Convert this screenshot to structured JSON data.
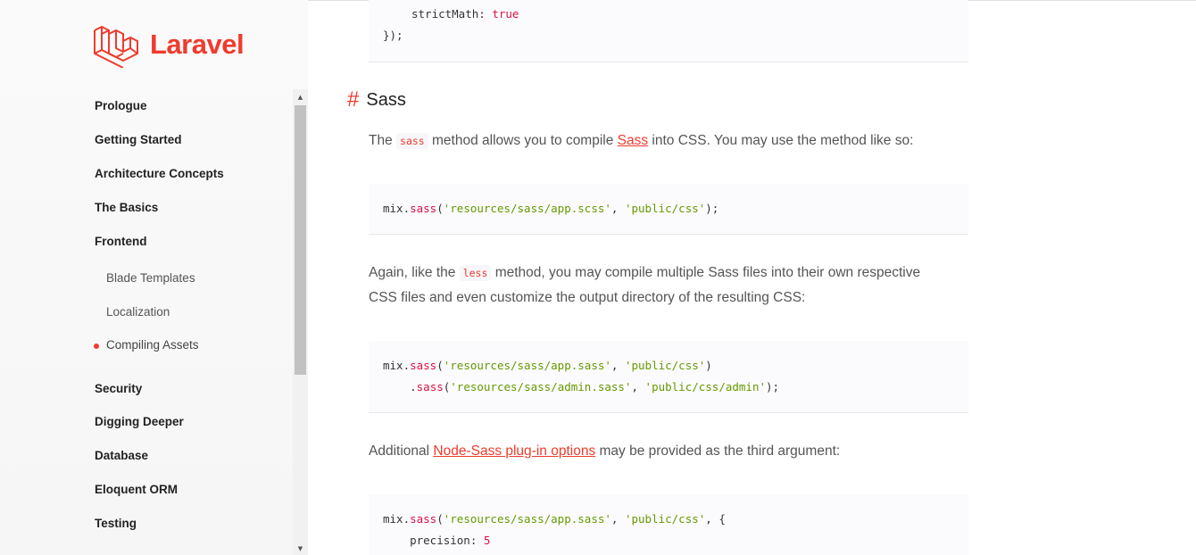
{
  "brand": {
    "name": "Laravel"
  },
  "sidebar": {
    "items": [
      {
        "label": "Prologue"
      },
      {
        "label": "Getting Started"
      },
      {
        "label": "Architecture Concepts"
      },
      {
        "label": "The Basics"
      },
      {
        "label": "Frontend"
      },
      {
        "label": "Security"
      },
      {
        "label": "Digging Deeper"
      },
      {
        "label": "Database"
      },
      {
        "label": "Eloquent ORM"
      },
      {
        "label": "Testing"
      }
    ],
    "subitems": [
      {
        "label": "Blade Templates"
      },
      {
        "label": "Localization"
      },
      {
        "label": "Compiling Assets",
        "active": true
      }
    ]
  },
  "content": {
    "prev_code": {
      "line1_key": "strictMath: ",
      "line1_val": "true",
      "line2": "});"
    },
    "heading": {
      "hash": "#",
      "title": "Sass"
    },
    "para1": {
      "pre": "The ",
      "code": "sass",
      "mid": " method allows you to compile ",
      "link": "Sass",
      "post": " into CSS. You may use the method like so:"
    },
    "code1": {
      "obj": "mix.",
      "fn": "sass",
      "open": "(",
      "arg1": "'resources/sass/app.scss'",
      "sep": ", ",
      "arg2": "'public/css'",
      "close": ");"
    },
    "para2": {
      "pre": "Again, like the ",
      "code": "less",
      "post": " method, you may compile multiple Sass files into their own respective CSS files and even customize the output directory of the resulting CSS:"
    },
    "code2": {
      "l1_obj": "mix.",
      "l1_fn": "sass",
      "l1_open": "(",
      "l1_arg1": "'resources/sass/app.sass'",
      "l1_sep": ", ",
      "l1_arg2": "'public/css'",
      "l1_close": ")",
      "l2_dot": "    .",
      "l2_fn": "sass",
      "l2_open": "(",
      "l2_arg1": "'resources/sass/admin.sass'",
      "l2_sep": ", ",
      "l2_arg2": "'public/css/admin'",
      "l2_close": ");"
    },
    "para3": {
      "pre": "Additional ",
      "link": "Node-Sass plug-in options",
      "post": " may be provided as the third argument:"
    },
    "code3": {
      "l1_obj": "mix.",
      "l1_fn": "sass",
      "l1_open": "(",
      "l1_arg1": "'resources/sass/app.sass'",
      "l1_sep": ", ",
      "l1_arg2": "'public/css'",
      "l1_close": ", {",
      "l2_key": "    precision: ",
      "l2_val": "5"
    }
  },
  "colors": {
    "accent": "#ef3b2d",
    "string": "#669900"
  }
}
